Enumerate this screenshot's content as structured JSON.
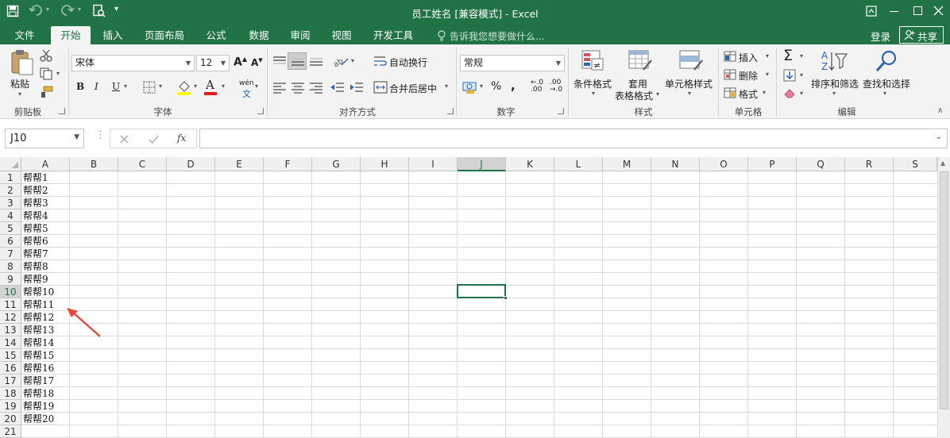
{
  "app": {
    "window_title": "员工姓名  [兼容模式] - Excel",
    "accent": "#217346",
    "title_controls": [
      "restore-ribbon",
      "minimize",
      "maximize",
      "close"
    ]
  },
  "tabs": [
    "文件",
    "开始",
    "插入",
    "页面布局",
    "公式",
    "数据",
    "审阅",
    "视图",
    "开发工具"
  ],
  "active_tab": "开始",
  "tell_me": "告诉我您想要做什么...",
  "login": "登录",
  "share": "共享",
  "ribbon": {
    "clipboard": {
      "label": "剪贴板",
      "paste": "粘贴"
    },
    "font": {
      "label": "字体",
      "name": "宋体",
      "size": "12",
      "bold": "B",
      "italic": "I",
      "underline": "U",
      "phonetic": "wén"
    },
    "alignment": {
      "label": "对齐方式",
      "wrap": "自动换行",
      "merge": "合并后居中"
    },
    "number": {
      "label": "数字",
      "format": "常规",
      "percent": "%",
      "comma": ","
    },
    "styles": {
      "label": "样式",
      "conditional": "条件格式",
      "table_line1": "套用",
      "table_line2": "表格格式",
      "cell_styles": "单元格样式"
    },
    "cells": {
      "label": "单元格",
      "insert": "插入",
      "delete": "删除",
      "format": "格式"
    },
    "editing": {
      "label": "编辑",
      "sort": "排序和筛选",
      "find": "查找和选择"
    }
  },
  "formula_bar": {
    "name_box": "J10",
    "fx": "fx",
    "formula": ""
  },
  "sheet": {
    "columns": [
      "A",
      "B",
      "C",
      "D",
      "E",
      "F",
      "G",
      "H",
      "I",
      "J",
      "K",
      "L",
      "M",
      "N",
      "O",
      "P",
      "Q",
      "R",
      "S"
    ],
    "rows": [
      "1",
      "2",
      "3",
      "4",
      "5",
      "6",
      "7",
      "8",
      "9",
      "10",
      "11",
      "12",
      "13",
      "14",
      "15",
      "16",
      "17",
      "18",
      "19",
      "20",
      "21"
    ],
    "column_a": [
      "帮帮1",
      "帮帮2",
      "帮帮3",
      "帮帮4",
      "帮帮5",
      "帮帮6",
      "帮帮7",
      "帮帮8",
      "帮帮9",
      "帮帮10",
      "帮帮11",
      "帮帮12",
      "帮帮13",
      "帮帮14",
      "帮帮15",
      "帮帮16",
      "帮帮17",
      "帮帮18",
      "帮帮19",
      "帮帮20"
    ],
    "selected_column": "J",
    "selected_row": "10",
    "arrow_color": "#e8473a"
  }
}
